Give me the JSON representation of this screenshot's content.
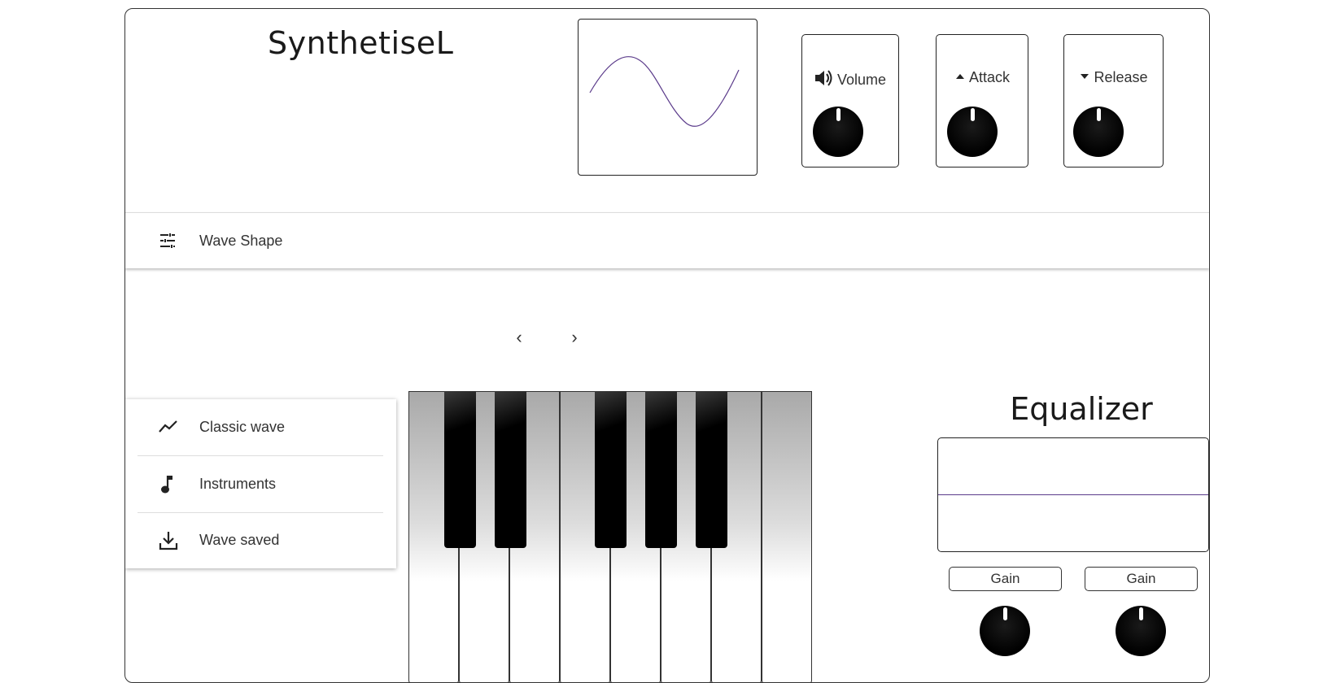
{
  "app": {
    "title": "SynthetiseL"
  },
  "knobs": [
    {
      "label": "Volume",
      "icon": "speaker-icon"
    },
    {
      "label": "Attack",
      "icon": "caret-up-icon"
    },
    {
      "label": "Release",
      "icon": "caret-down-icon"
    }
  ],
  "toolbar": {
    "label": "Wave Shape",
    "icon": "tune-icon"
  },
  "side_menu": {
    "items": [
      {
        "label": "Classic wave",
        "icon": "trending-line-icon"
      },
      {
        "label": "Instruments",
        "icon": "music-note-icon"
      },
      {
        "label": "Wave saved",
        "icon": "download-icon"
      }
    ]
  },
  "equalizer": {
    "title": "Equalizer",
    "gains": [
      {
        "label": "Gain"
      },
      {
        "label": "Gain"
      }
    ]
  },
  "colors": {
    "wave_stroke": "#5a3a8a",
    "frame": "#333333",
    "knob": "#000000"
  }
}
